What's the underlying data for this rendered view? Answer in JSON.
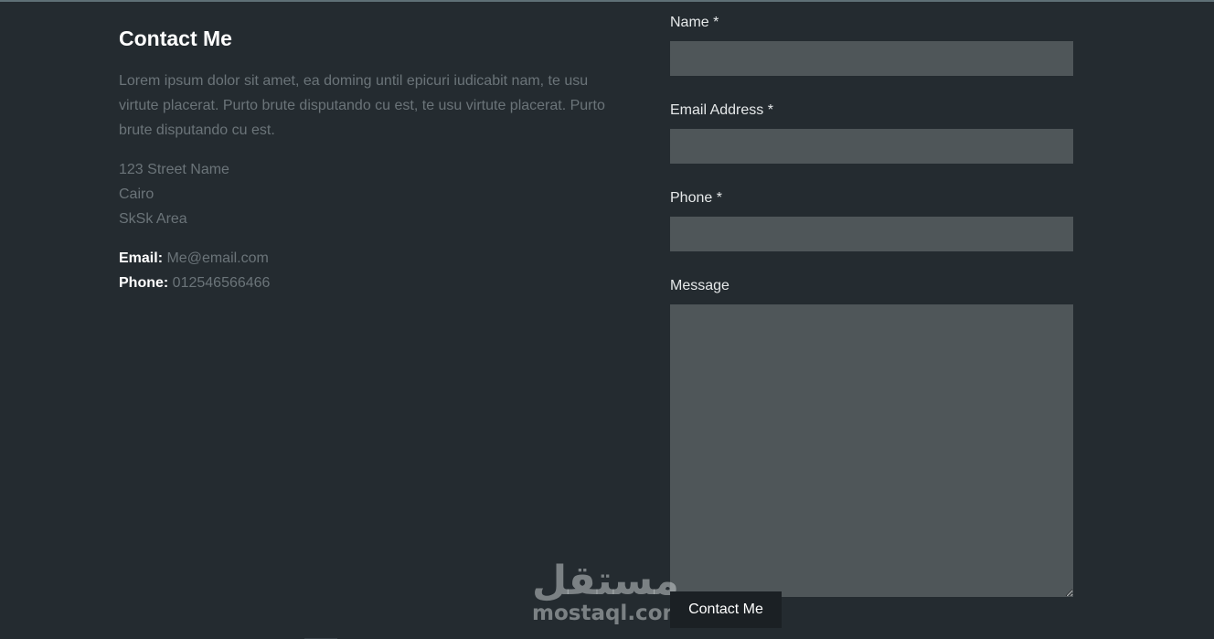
{
  "info": {
    "title": "Contact Me",
    "description": "Lorem ipsum dolor sit amet, ea doming until epicuri iudicabit nam, te usu virtute placerat. Purto brute disputando cu est, te usu virtute placerat. Purto brute disputando cu est.",
    "address": [
      "123 Street Name",
      "Cairo",
      "SkSk Area"
    ],
    "email_key": "Email:",
    "email_value": "Me@email.com",
    "phone_key": "Phone:",
    "phone_value": "012546566466"
  },
  "form": {
    "name_label": "Name *",
    "name_value": "",
    "email_label": "Email Address *",
    "email_value": "",
    "phone_label": "Phone *",
    "phone_value": "",
    "message_label": "Message",
    "message_value": "",
    "submit_label": "Contact Me"
  },
  "watermark": {
    "glyph": "مستقل",
    "text": "mostaql.com"
  },
  "colors": {
    "background": "#242b30",
    "input_bg": "#4f5659",
    "muted_text": "#6b7479",
    "button_bg": "#1b2024"
  }
}
